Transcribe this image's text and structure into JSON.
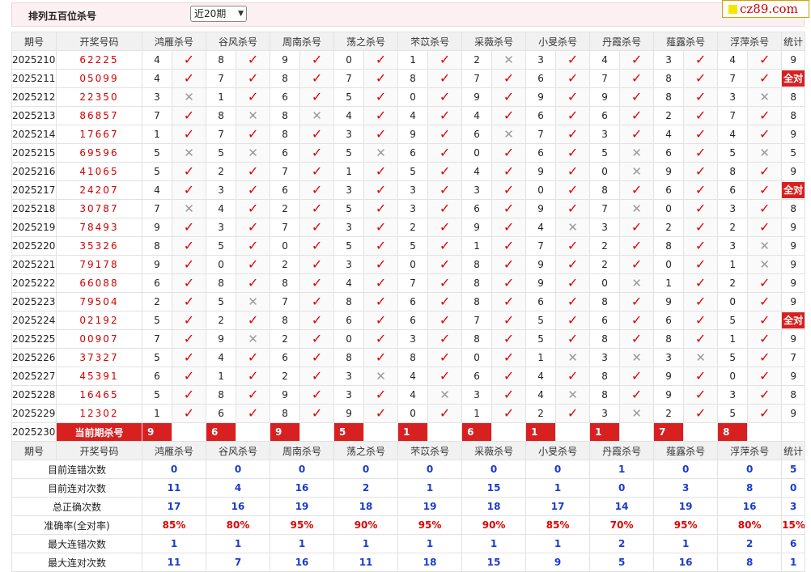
{
  "header": {
    "title": "排列五百位杀号",
    "period_select": "近20期",
    "logo_text": "cz89.com"
  },
  "table": {
    "columns": [
      "期号",
      "开奖号码",
      "鸿雁杀号",
      "谷风杀号",
      "周南杀号",
      "荡之杀号",
      "芣苡杀号",
      "采薇杀号",
      "小旻杀号",
      "丹霞杀号",
      "薤露杀号",
      "浮萍杀号",
      "统计"
    ],
    "rows": [
      {
        "issue": "2025210",
        "draw": "62225",
        "n": [
          4,
          8,
          9,
          0,
          1,
          2,
          3,
          4,
          3,
          4
        ],
        "ok": [
          1,
          1,
          1,
          1,
          1,
          0,
          1,
          1,
          1,
          1
        ],
        "stat": "9"
      },
      {
        "issue": "2025211",
        "draw": "05099",
        "n": [
          4,
          7,
          8,
          7,
          8,
          7,
          6,
          7,
          8,
          7
        ],
        "ok": [
          1,
          1,
          1,
          1,
          1,
          1,
          1,
          1,
          1,
          1
        ],
        "stat": "全对"
      },
      {
        "issue": "2025212",
        "draw": "22350",
        "n": [
          3,
          1,
          6,
          5,
          0,
          9,
          9,
          9,
          8,
          3
        ],
        "ok": [
          0,
          1,
          1,
          1,
          1,
          1,
          1,
          1,
          1,
          0
        ],
        "stat": "8"
      },
      {
        "issue": "2025213",
        "draw": "86857",
        "n": [
          7,
          8,
          8,
          4,
          4,
          4,
          6,
          6,
          2,
          7
        ],
        "ok": [
          1,
          0,
          0,
          1,
          1,
          1,
          1,
          1,
          1,
          1
        ],
        "stat": "8"
      },
      {
        "issue": "2025214",
        "draw": "17667",
        "n": [
          1,
          7,
          8,
          3,
          9,
          6,
          7,
          3,
          4,
          4
        ],
        "ok": [
          1,
          1,
          1,
          1,
          1,
          0,
          1,
          1,
          1,
          1
        ],
        "stat": "9"
      },
      {
        "issue": "2025215",
        "draw": "69596",
        "n": [
          5,
          5,
          6,
          5,
          6,
          0,
          6,
          5,
          6,
          5
        ],
        "ok": [
          0,
          0,
          1,
          0,
          1,
          1,
          1,
          0,
          1,
          0
        ],
        "stat": "5"
      },
      {
        "issue": "2025216",
        "draw": "41065",
        "n": [
          5,
          2,
          7,
          1,
          5,
          4,
          9,
          0,
          9,
          8
        ],
        "ok": [
          1,
          1,
          1,
          1,
          1,
          1,
          1,
          0,
          1,
          1
        ],
        "stat": "9"
      },
      {
        "issue": "2025217",
        "draw": "24207",
        "n": [
          4,
          3,
          6,
          3,
          3,
          3,
          0,
          8,
          6,
          6
        ],
        "ok": [
          1,
          1,
          1,
          1,
          1,
          1,
          1,
          1,
          1,
          1
        ],
        "stat": "全对"
      },
      {
        "issue": "2025218",
        "draw": "30787",
        "n": [
          7,
          4,
          2,
          5,
          3,
          6,
          9,
          7,
          0,
          3
        ],
        "ok": [
          0,
          1,
          1,
          1,
          1,
          1,
          1,
          0,
          1,
          1
        ],
        "stat": "8"
      },
      {
        "issue": "2025219",
        "draw": "78493",
        "n": [
          9,
          3,
          7,
          3,
          2,
          9,
          4,
          3,
          2,
          2
        ],
        "ok": [
          1,
          1,
          1,
          1,
          1,
          1,
          0,
          1,
          1,
          1
        ],
        "stat": "9"
      },
      {
        "issue": "2025220",
        "draw": "35326",
        "n": [
          8,
          5,
          0,
          5,
          5,
          1,
          7,
          2,
          8,
          3
        ],
        "ok": [
          1,
          1,
          1,
          1,
          1,
          1,
          1,
          1,
          1,
          0
        ],
        "stat": "9"
      },
      {
        "issue": "2025221",
        "draw": "79178",
        "n": [
          9,
          0,
          2,
          3,
          0,
          8,
          9,
          2,
          0,
          1
        ],
        "ok": [
          1,
          1,
          1,
          1,
          1,
          1,
          1,
          1,
          1,
          0
        ],
        "stat": "9"
      },
      {
        "issue": "2025222",
        "draw": "66088",
        "n": [
          6,
          8,
          8,
          4,
          7,
          8,
          9,
          0,
          1,
          2
        ],
        "ok": [
          1,
          1,
          1,
          1,
          1,
          1,
          1,
          0,
          1,
          1
        ],
        "stat": "9"
      },
      {
        "issue": "2025223",
        "draw": "79504",
        "n": [
          2,
          5,
          7,
          8,
          6,
          8,
          6,
          8,
          9,
          0
        ],
        "ok": [
          1,
          0,
          1,
          1,
          1,
          1,
          1,
          1,
          1,
          1
        ],
        "stat": "9"
      },
      {
        "issue": "2025224",
        "draw": "02192",
        "n": [
          5,
          2,
          8,
          6,
          6,
          7,
          5,
          6,
          6,
          5
        ],
        "ok": [
          1,
          1,
          1,
          1,
          1,
          1,
          1,
          1,
          1,
          1
        ],
        "stat": "全对"
      },
      {
        "issue": "2025225",
        "draw": "00907",
        "n": [
          7,
          9,
          2,
          0,
          3,
          8,
          5,
          8,
          8,
          1
        ],
        "ok": [
          1,
          0,
          1,
          1,
          1,
          1,
          1,
          1,
          1,
          1
        ],
        "stat": "9"
      },
      {
        "issue": "2025226",
        "draw": "37327",
        "n": [
          5,
          4,
          6,
          8,
          8,
          0,
          1,
          3,
          3,
          5
        ],
        "ok": [
          1,
          1,
          1,
          1,
          1,
          1,
          0,
          0,
          0,
          1
        ],
        "stat": "7"
      },
      {
        "issue": "2025227",
        "draw": "45391",
        "n": [
          6,
          1,
          2,
          3,
          4,
          6,
          4,
          8,
          9,
          0
        ],
        "ok": [
          1,
          1,
          1,
          0,
          1,
          1,
          1,
          1,
          1,
          1
        ],
        "stat": "9"
      },
      {
        "issue": "2025228",
        "draw": "16465",
        "n": [
          5,
          8,
          9,
          3,
          4,
          3,
          4,
          8,
          9,
          3
        ],
        "ok": [
          1,
          1,
          1,
          1,
          0,
          1,
          0,
          1,
          1,
          1
        ],
        "stat": "8"
      },
      {
        "issue": "2025229",
        "draw": "12302",
        "n": [
          1,
          6,
          8,
          9,
          0,
          1,
          2,
          3,
          2,
          5
        ],
        "ok": [
          1,
          1,
          1,
          1,
          1,
          1,
          1,
          0,
          1,
          1
        ],
        "stat": "9"
      }
    ],
    "current": {
      "issue": "2025230",
      "label": "当前期杀号",
      "n": [
        "9",
        "6",
        "9",
        "5",
        "1",
        "6",
        "1",
        "1",
        "7",
        "8"
      ]
    }
  },
  "summary": [
    {
      "label": "目前连错次数",
      "vals": [
        "0",
        "0",
        "0",
        "0",
        "0",
        "0",
        "0",
        "1",
        "0",
        "0",
        "5"
      ]
    },
    {
      "label": "目前连对次数",
      "vals": [
        "11",
        "4",
        "16",
        "2",
        "1",
        "15",
        "1",
        "0",
        "3",
        "8",
        "0"
      ]
    },
    {
      "label": "总正确次数",
      "vals": [
        "17",
        "16",
        "19",
        "18",
        "19",
        "18",
        "17",
        "14",
        "19",
        "16",
        "3"
      ]
    },
    {
      "label": "准确率(全对率)",
      "vals": [
        "85%",
        "80%",
        "95%",
        "90%",
        "95%",
        "90%",
        "85%",
        "70%",
        "95%",
        "80%",
        "15%"
      ],
      "red": true
    },
    {
      "label": "最大连错次数",
      "vals": [
        "1",
        "1",
        "1",
        "1",
        "1",
        "1",
        "1",
        "2",
        "1",
        "2",
        "6"
      ]
    },
    {
      "label": "最大连对次数",
      "vals": [
        "11",
        "7",
        "16",
        "11",
        "18",
        "15",
        "9",
        "5",
        "16",
        "8",
        "1"
      ]
    }
  ],
  "colors": {
    "accent_red": "#d82020",
    "value_blue": "#1a3ccc",
    "check_red": "#e00000",
    "cross_gray": "#9a9a9a"
  },
  "icons": {
    "correct": "check-icon",
    "wrong": "cross-icon"
  }
}
